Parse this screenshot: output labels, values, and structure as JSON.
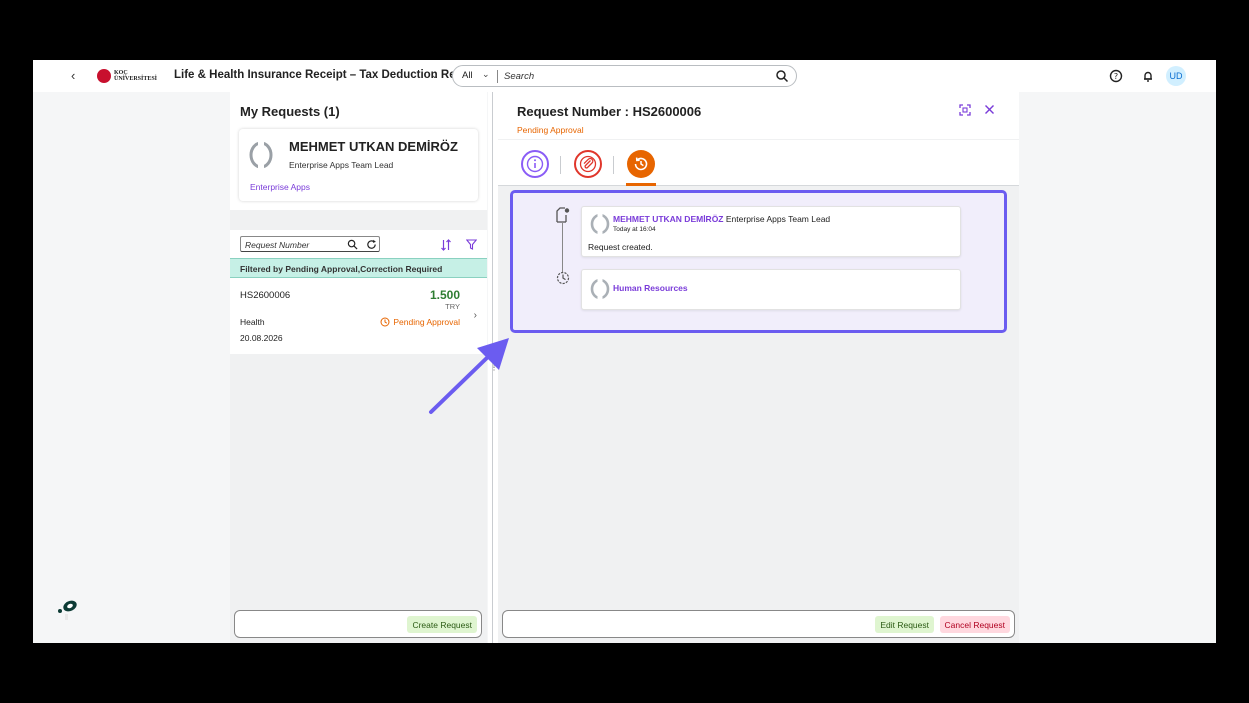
{
  "shell": {
    "app_title": "Life & Health Insurance Receipt – Tax Deduction Req...",
    "logo_text_line1": "KOÇ",
    "logo_text_line2": "ÜNİVERSİTESİ",
    "search_scope": "All",
    "search_placeholder": "Search",
    "user_initials": "UD"
  },
  "master": {
    "title": "My Requests (1)",
    "profile": {
      "name": "MEHMET UTKAN DEMİRÖZ",
      "role": "Enterprise Apps Team Lead",
      "department": "Enterprise Apps"
    },
    "list_search_placeholder": "Request Number",
    "filter_info": "Filtered by Pending Approval,Correction Required",
    "items": [
      {
        "id": "HS2600006",
        "amount": "1.500",
        "currency": "TRY",
        "type": "Health",
        "date": "20.08.2026",
        "status": "Pending Approval"
      }
    ],
    "create_label": "Create Request"
  },
  "detail": {
    "title": "Request Number : HS2600006",
    "status": "Pending Approval",
    "tabs": [
      "info-icon",
      "attachment-icon",
      "history-icon"
    ],
    "timeline": [
      {
        "name": "MEHMET UTKAN DEMİRÖZ",
        "role": "Enterprise Apps Team Lead",
        "time": "Today at 16:04",
        "message": "Request created."
      },
      {
        "name": "Human Resources"
      }
    ],
    "edit_label": "Edit Request",
    "cancel_label": "Cancel Request"
  },
  "colors": {
    "accent_purple": "#7a3cd9",
    "highlight_border": "#6b5cf0",
    "pending_orange": "#e76500",
    "amount_green": "#2e7d32",
    "filter_bar": "#c6f0e6"
  }
}
